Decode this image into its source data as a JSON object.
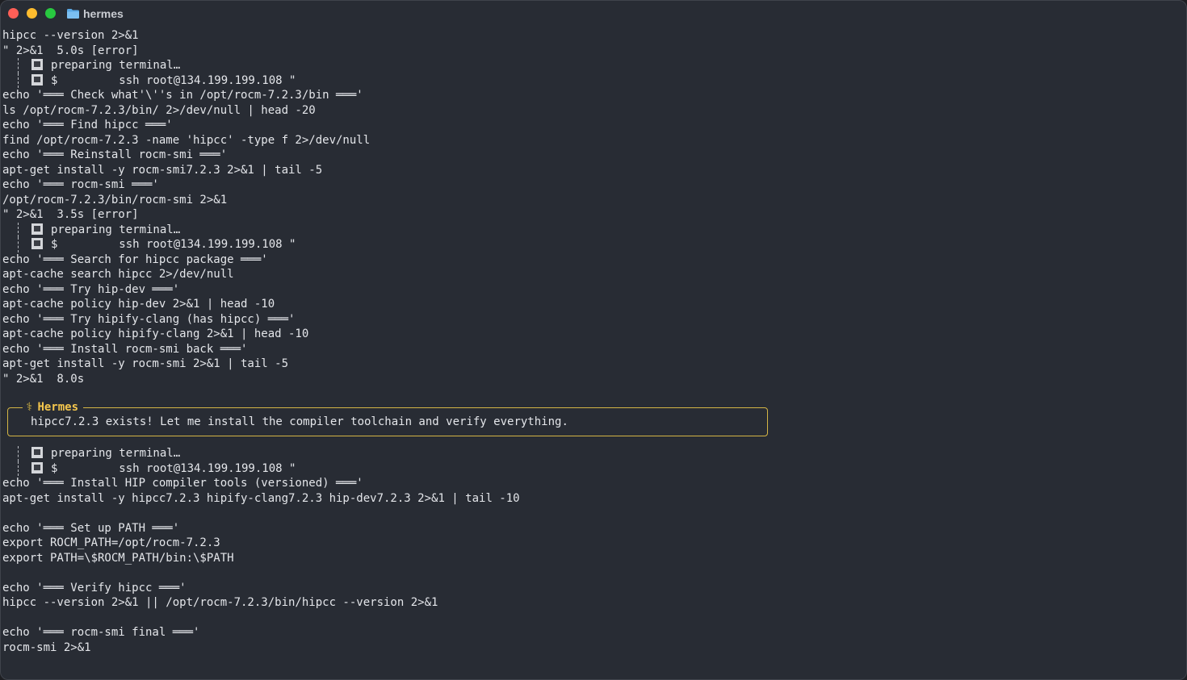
{
  "window": {
    "title": "hermes",
    "icon": "folder-icon"
  },
  "lines": [
    {
      "type": "plain",
      "text": "hipcc --version 2>&1"
    },
    {
      "type": "plain",
      "text": "\" 2>&1  5.0s [error]"
    },
    {
      "type": "indent",
      "text": "preparing terminal…"
    },
    {
      "type": "indent",
      "text": "$         ssh root@134.199.199.108 \""
    },
    {
      "type": "plain",
      "text": "echo '═══ Check what'\\''s in /opt/rocm-7.2.3/bin ═══'"
    },
    {
      "type": "plain",
      "text": "ls /opt/rocm-7.2.3/bin/ 2>/dev/null | head -20"
    },
    {
      "type": "plain",
      "text": "echo '═══ Find hipcc ═══'"
    },
    {
      "type": "plain",
      "text": "find /opt/rocm-7.2.3 -name 'hipcc' -type f 2>/dev/null"
    },
    {
      "type": "plain",
      "text": "echo '═══ Reinstall rocm-smi ═══'"
    },
    {
      "type": "plain",
      "text": "apt-get install -y rocm-smi7.2.3 2>&1 | tail -5"
    },
    {
      "type": "plain",
      "text": "echo '═══ rocm-smi ═══'"
    },
    {
      "type": "plain",
      "text": "/opt/rocm-7.2.3/bin/rocm-smi 2>&1"
    },
    {
      "type": "plain",
      "text": "\" 2>&1  3.5s [error]"
    },
    {
      "type": "indent",
      "text": "preparing terminal…"
    },
    {
      "type": "indent",
      "text": "$         ssh root@134.199.199.108 \""
    },
    {
      "type": "plain",
      "text": "echo '═══ Search for hipcc package ═══'"
    },
    {
      "type": "plain",
      "text": "apt-cache search hipcc 2>/dev/null"
    },
    {
      "type": "plain",
      "text": "echo '═══ Try hip-dev ═══'"
    },
    {
      "type": "plain",
      "text": "apt-cache policy hip-dev 2>&1 | head -10"
    },
    {
      "type": "plain",
      "text": "echo '═══ Try hipify-clang (has hipcc) ═══'"
    },
    {
      "type": "plain",
      "text": "apt-cache policy hipify-clang 2>&1 | head -10"
    },
    {
      "type": "plain",
      "text": "echo '═══ Install rocm-smi back ═══'"
    },
    {
      "type": "plain",
      "text": "apt-get install -y rocm-smi 2>&1 | tail -5"
    },
    {
      "type": "plain",
      "text": "\" 2>&1  8.0s"
    }
  ],
  "hermes_box": {
    "symbol": "⚕",
    "label": "Hermes",
    "message": "hipcc7.2.3 exists! Let me install the compiler toolchain and verify everything.",
    "border_color": "#d4b545"
  },
  "lines_after": [
    {
      "type": "indent",
      "text": "preparing terminal…"
    },
    {
      "type": "indent",
      "text": "$         ssh root@134.199.199.108 \""
    },
    {
      "type": "plain",
      "text": "echo '═══ Install HIP compiler tools (versioned) ═══'"
    },
    {
      "type": "plain",
      "text": "apt-get install -y hipcc7.2.3 hipify-clang7.2.3 hip-dev7.2.3 2>&1 | tail -10"
    },
    {
      "type": "plain",
      "text": ""
    },
    {
      "type": "plain",
      "text": "echo '═══ Set up PATH ═══'"
    },
    {
      "type": "plain",
      "text": "export ROCM_PATH=/opt/rocm-7.2.3"
    },
    {
      "type": "plain",
      "text": "export PATH=\\$ROCM_PATH/bin:\\$PATH"
    },
    {
      "type": "plain",
      "text": ""
    },
    {
      "type": "plain",
      "text": "echo '═══ Verify hipcc ═══'"
    },
    {
      "type": "plain",
      "text": "hipcc --version 2>&1 || /opt/rocm-7.2.3/bin/hipcc --version 2>&1"
    },
    {
      "type": "plain",
      "text": ""
    },
    {
      "type": "plain",
      "text": "echo '═══ rocm-smi final ═══'"
    },
    {
      "type": "plain",
      "text": "rocm-smi 2>&1"
    }
  ],
  "colors": {
    "background": "#282c34",
    "text": "#e4e6ea",
    "accent": "#f4c64d"
  }
}
